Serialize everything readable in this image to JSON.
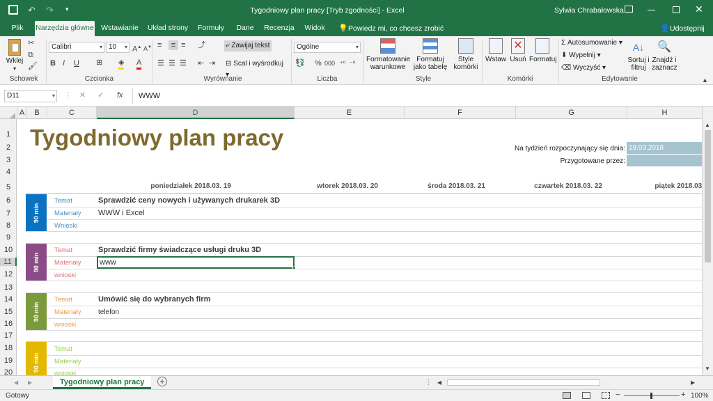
{
  "window": {
    "title": "Tygodniowy plan pracy  [Tryb zgodności]  -  Excel",
    "user": "Sylwia Chrabałowska",
    "save_icon": "save-icon",
    "undo_icon": "undo-icon",
    "redo_icon": "redo-icon"
  },
  "ribbon_tabs": [
    "Plik",
    "Narzędzia główne",
    "Wstawianie",
    "Układ strony",
    "Formuły",
    "Dane",
    "Recenzja",
    "Widok"
  ],
  "tell_me": "Powiedz mi, co chcesz zrobić",
  "share": "Udostępnij",
  "ribbon": {
    "clipboard": {
      "paste": "Wklej",
      "label": "Schowek"
    },
    "font": {
      "name": "Calibri",
      "size": "10",
      "bold": "B",
      "italic": "I",
      "underline": "U",
      "label": "Czcionka",
      "font_color": "#e81123",
      "fill_color": "#ffd700"
    },
    "alignment": {
      "wrap": "Zawijaj tekst",
      "merge": "Scal i wyśrodkuj",
      "label": "Wyrównanie"
    },
    "number": {
      "format": "Ogólne",
      "percent": "%",
      "thousands": "000",
      "label": "Liczba"
    },
    "styles": {
      "conditional": "Formatowanie warunkowe",
      "table": "Formatuj jako tabelę",
      "cell_styles": "Style komórki",
      "label": "Style"
    },
    "cells": {
      "insert": "Wstaw",
      "delete": "Usuń",
      "format": "Formatuj",
      "label": "Komórki"
    },
    "editing": {
      "autosum": "Autosumowanie",
      "fill": "Wypełnij",
      "clear": "Wyczyść",
      "sort": "Sortuj i filtruj",
      "find": "Znajdź i zaznacz",
      "label": "Edytowanie"
    }
  },
  "formula_bar": {
    "name_box": "D11",
    "fx": "fx",
    "value": "WWW"
  },
  "columns": [
    "A",
    "B",
    "C",
    "D",
    "E",
    "F",
    "G",
    "H"
  ],
  "rows": [
    "1",
    "2",
    "3",
    "4",
    "5",
    "6",
    "7",
    "8",
    "9",
    "10",
    "11",
    "12",
    "13",
    "14",
    "15",
    "16",
    "17",
    "18",
    "19",
    "20"
  ],
  "sheet": {
    "title": "Tygodniowy plan pracy",
    "week_label": "Na tydzień rozpoczynający się dnia:",
    "week_value": "19.03.2018",
    "prepared_label": "Przygotowane przez:",
    "prepared_value": "",
    "days": [
      "poniedziałek 2018.03. 19",
      "wtorek 2018.03. 20",
      "środa 2018.03. 21",
      "czwartek 2018.03. 22",
      "piątek 2018.03."
    ],
    "blocks": [
      {
        "duration": "90 min",
        "color": "#0a72c0",
        "label_color": "#4a90c4",
        "topic_label": "Temat",
        "topic": "Sprawdzić ceny nowych i używanych drukarek 3D",
        "materials_label": "Materiały",
        "materials": "WWW i Excel",
        "notes_label": "Wnioski"
      },
      {
        "duration": "90 min",
        "color": "#8a4c86",
        "label_color": "#e0707a",
        "topic_label": "Temat",
        "topic": "Sprawdzić firmy świadczące usługi druku 3D",
        "materials_label": "Materiały",
        "materials": "www",
        "notes_label": "wnioski"
      },
      {
        "duration": "90 min",
        "color": "#7c9a3c",
        "label_color": "#e99a4c",
        "topic_label": "Temat",
        "topic": "Umówić się do wybranych firm",
        "materials_label": "Materiały",
        "materials": "telefon",
        "notes_label": "wnioski"
      },
      {
        "duration": "90 min",
        "color": "#e3b800",
        "label_color": "#9ccd5a",
        "topic_label": "Temat",
        "topic": "",
        "materials_label": "Materiały",
        "materials": "",
        "notes_label": "wnioski"
      }
    ]
  },
  "sheet_tab": "Tygodniowy plan pracy",
  "status": {
    "ready": "Gotowy",
    "zoom": "100%"
  }
}
